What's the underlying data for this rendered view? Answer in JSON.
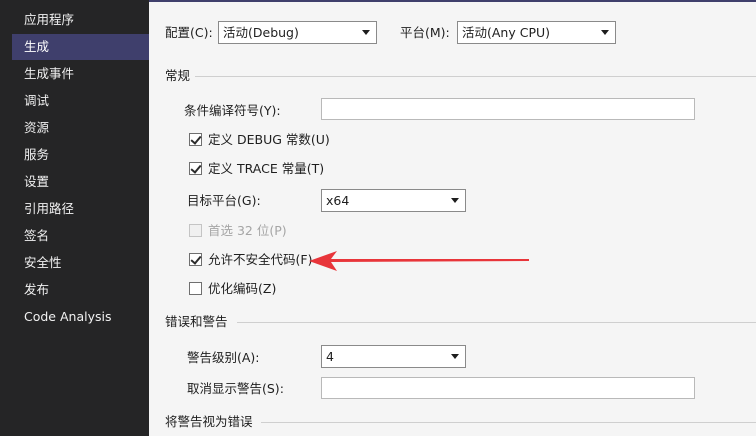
{
  "sidebar": {
    "items": [
      {
        "label": "应用程序"
      },
      {
        "label": "生成",
        "active": true
      },
      {
        "label": "生成事件"
      },
      {
        "label": "调试"
      },
      {
        "label": "资源"
      },
      {
        "label": "服务"
      },
      {
        "label": "设置"
      },
      {
        "label": "引用路径"
      },
      {
        "label": "签名"
      },
      {
        "label": "安全性"
      },
      {
        "label": "发布"
      },
      {
        "label": "Code Analysis"
      }
    ]
  },
  "config": {
    "label": "配置(C):",
    "value": "活动(Debug)",
    "platform_label": "平台(M):",
    "platform_value": "活动(Any CPU)"
  },
  "general": {
    "title": "常规",
    "conditional_symbols_label": "条件编译符号(Y):",
    "conditional_symbols_value": "",
    "define_debug": {
      "label": "定义 DEBUG 常数(U)",
      "checked": true
    },
    "define_trace": {
      "label": "定义 TRACE 常量(T)",
      "checked": true
    },
    "target_platform_label": "目标平台(G):",
    "target_platform_value": "x64",
    "prefer32": {
      "label": "首选 32 位(P)",
      "checked": false,
      "disabled": true
    },
    "allow_unsafe": {
      "label": "允许不安全代码(F)",
      "checked": true
    },
    "optimize": {
      "label": "优化编码(Z)",
      "checked": false
    }
  },
  "errors": {
    "title": "错误和警告",
    "warning_level_label": "警告级别(A):",
    "warning_level_value": "4",
    "suppress_label": "取消显示警告(S):",
    "suppress_value": ""
  },
  "treat_warnings": {
    "title": "将警告视为错误"
  },
  "annotation": {
    "arrow_color": "#e8353a"
  },
  "colors": {
    "sidebar_bg": "#252526",
    "sidebar_active": "#3f3f6c",
    "main_bg": "#f5f5f5"
  }
}
